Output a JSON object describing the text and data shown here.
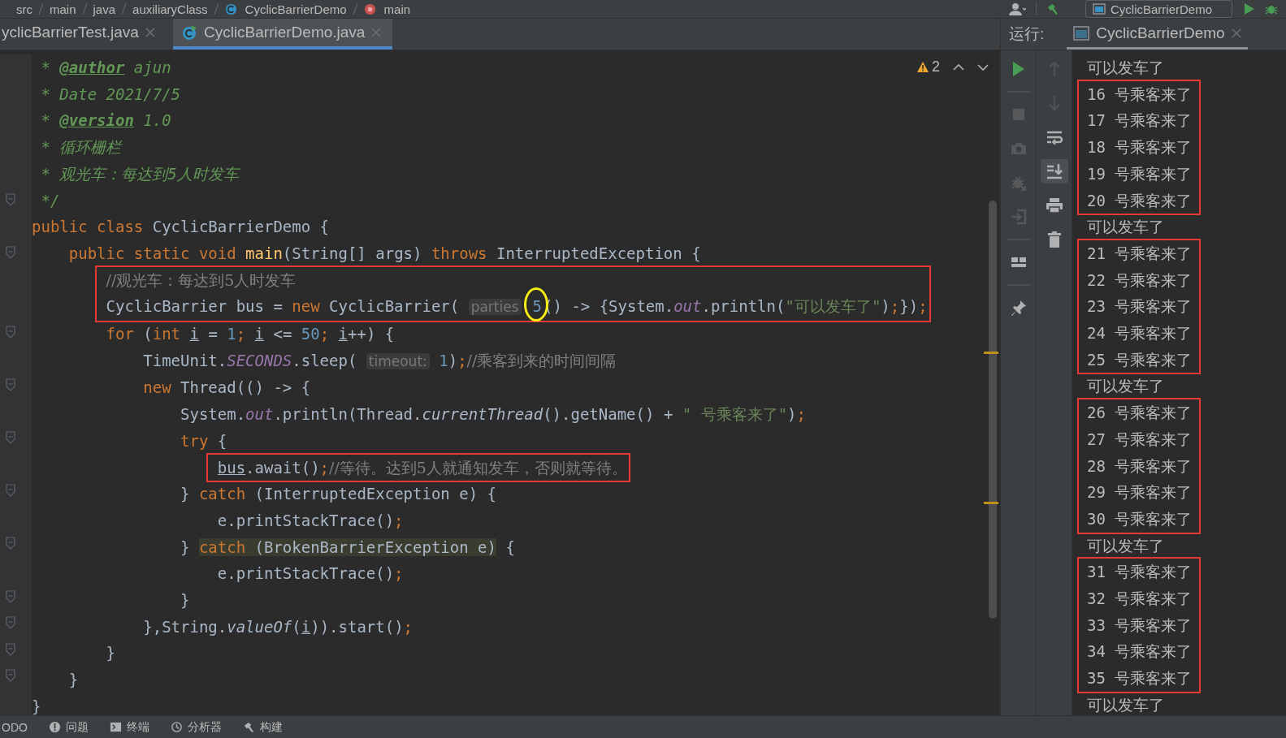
{
  "breadcrumb": [
    {
      "kind": "folder",
      "label": "src"
    },
    {
      "kind": "folder",
      "label": "main"
    },
    {
      "kind": "folder",
      "label": "java"
    },
    {
      "kind": "folder",
      "label": "auxiliaryClass"
    },
    {
      "kind": "class",
      "label": "CyclicBarrierDemo"
    },
    {
      "kind": "method",
      "label": "main"
    }
  ],
  "run_config": {
    "label": "CyclicBarrierDemo"
  },
  "editor_tabs": [
    {
      "label": "yclicBarrierTest.java",
      "selected": false
    },
    {
      "label": "CyclicBarrierDemo.java",
      "selected": true
    }
  ],
  "inspections": {
    "warnings": "2"
  },
  "code": [
    {
      "kind": "doc",
      "fold": false,
      "tokens": [
        {
          "kind": "doc",
          "text": "* "
        },
        {
          "kind": "tag",
          "text": "@author"
        },
        {
          "kind": "doc",
          "text": " ajun"
        }
      ]
    },
    {
      "kind": "doc",
      "fold": false,
      "tokens": [
        {
          "kind": "doc",
          "text": "* Date 2021/7/5"
        }
      ]
    },
    {
      "kind": "doc",
      "fold": false,
      "tokens": [
        {
          "kind": "doc",
          "text": "* "
        },
        {
          "kind": "tag",
          "text": "@version"
        },
        {
          "kind": "doc",
          "text": " 1.0"
        }
      ]
    },
    {
      "kind": "doc",
      "fold": false,
      "tokens": [
        {
          "kind": "doc",
          "text": "* 循环栅栏"
        }
      ]
    },
    {
      "kind": "doc",
      "fold": false,
      "tokens": [
        {
          "kind": "doc",
          "text": "* 观光车：每达到5人时发车"
        }
      ]
    },
    {
      "kind": "doc",
      "fold": true,
      "tokens": [
        {
          "kind": "doc",
          "text": "*/"
        }
      ]
    },
    {
      "kind": "line",
      "fold": false,
      "tokens": [
        {
          "kind": "kw",
          "text": "public class "
        },
        {
          "kind": "p",
          "text": "CyclicBarrierDemo {"
        }
      ],
      "children": [
        {
          "kind": "line",
          "fold": true,
          "tokens": [
            {
              "kind": "kw",
              "text": "public static void "
            },
            {
              "kind": "fn",
              "text": "main"
            },
            {
              "kind": "p",
              "text": "(String[] args) "
            },
            {
              "kind": "kw",
              "text": "throws "
            },
            {
              "kind": "p",
              "text": "InterruptedException {"
            }
          ],
          "children": [
            {
              "kind": "box",
              "lines": [
                {
                  "fold": false,
                  "tokens": [
                    {
                      "kind": "cm",
                      "text": "//观光车：每达到5人时发车"
                    }
                  ]
                },
                {
                  "fold": false,
                  "tokens": [
                    {
                      "kind": "p",
                      "text": "CyclicBarrier bus = "
                    },
                    {
                      "kind": "kw",
                      "text": "new "
                    },
                    {
                      "kind": "p",
                      "text": "CyclicBarrier( "
                    },
                    {
                      "kind": "hint",
                      "text": "parties"
                    },
                    {
                      "kind": "circ",
                      "text": "5"
                    },
                    {
                      "kind": "p",
                      "text": "() -> {System."
                    },
                    {
                      "kind": "fld",
                      "text": "out"
                    },
                    {
                      "kind": "p",
                      "text": ".println("
                    },
                    {
                      "kind": "str",
                      "text": "\"可以发车了\""
                    },
                    {
                      "kind": "p",
                      "text": ")"
                    },
                    {
                      "kind": "kw",
                      "text": ";"
                    },
                    {
                      "kind": "p",
                      "text": "})"
                    },
                    {
                      "kind": "kw",
                      "text": ";"
                    }
                  ]
                }
              ]
            },
            {
              "kind": "line",
              "fold": true,
              "tokens": [
                {
                  "kind": "kw",
                  "text": "for "
                },
                {
                  "kind": "p",
                  "text": "("
                },
                {
                  "kind": "kw",
                  "text": "int "
                },
                {
                  "kind": "var",
                  "text": "i"
                },
                {
                  "kind": "p",
                  "text": " = "
                },
                {
                  "kind": "num",
                  "text": "1"
                },
                {
                  "kind": "kw",
                  "text": "; "
                },
                {
                  "kind": "var",
                  "text": "i"
                },
                {
                  "kind": "p",
                  "text": " <= "
                },
                {
                  "kind": "num",
                  "text": "50"
                },
                {
                  "kind": "kw",
                  "text": "; "
                },
                {
                  "kind": "var",
                  "text": "i"
                },
                {
                  "kind": "p",
                  "text": "++) {"
                }
              ],
              "children": [
                {
                  "kind": "line",
                  "fold": false,
                  "tokens": [
                    {
                      "kind": "p",
                      "text": "TimeUnit."
                    },
                    {
                      "kind": "fld",
                      "text": "SECONDS"
                    },
                    {
                      "kind": "p",
                      "text": ".sleep( "
                    },
                    {
                      "kind": "hint",
                      "text": "timeout:"
                    },
                    {
                      "kind": "num",
                      "text": "1"
                    },
                    {
                      "kind": "p",
                      "text": ")"
                    },
                    {
                      "kind": "kw",
                      "text": ";"
                    },
                    {
                      "kind": "cm",
                      "text": "//乘客到来的时间间隔"
                    }
                  ]
                },
                {
                  "kind": "line",
                  "fold": true,
                  "tokens": [
                    {
                      "kind": "kw",
                      "text": "new "
                    },
                    {
                      "kind": "p",
                      "text": "Thread(() -> {"
                    }
                  ],
                  "children": [
                    {
                      "kind": "line",
                      "fold": false,
                      "tokens": [
                        {
                          "kind": "p",
                          "text": "System."
                        },
                        {
                          "kind": "fld",
                          "text": "out"
                        },
                        {
                          "kind": "p",
                          "text": ".println(Thread."
                        },
                        {
                          "kind": "itm",
                          "text": "currentThread"
                        },
                        {
                          "kind": "p",
                          "text": "().getName() + "
                        },
                        {
                          "kind": "str",
                          "text": "\" 号乘客来了\""
                        },
                        {
                          "kind": "p",
                          "text": ")"
                        },
                        {
                          "kind": "kw",
                          "text": ";"
                        }
                      ]
                    },
                    {
                      "kind": "line",
                      "fold": true,
                      "tokens": [
                        {
                          "kind": "kw",
                          "text": "try "
                        },
                        {
                          "kind": "p",
                          "text": "{"
                        }
                      ],
                      "children": [
                        {
                          "kind": "box",
                          "lines": [
                            {
                              "fold": false,
                              "tokens": [
                                {
                                  "kind": "ul",
                                  "text": "bus"
                                },
                                {
                                  "kind": "p",
                                  "text": ".await()"
                                },
                                {
                                  "kind": "kw",
                                  "text": ";"
                                },
                                {
                                  "kind": "cm",
                                  "text": "//等待。达到5人就通知发车，否则就等待。"
                                }
                              ]
                            }
                          ]
                        }
                      ]
                    },
                    {
                      "kind": "line",
                      "fold": true,
                      "tokens": [
                        {
                          "kind": "p",
                          "text": "} "
                        },
                        {
                          "kind": "kw",
                          "text": "catch "
                        },
                        {
                          "kind": "p",
                          "text": "(InterruptedException e) {"
                        }
                      ],
                      "children": [
                        {
                          "kind": "line",
                          "fold": false,
                          "tokens": [
                            {
                              "kind": "p",
                              "text": "e.printStackTrace()"
                            },
                            {
                              "kind": "kw",
                              "text": ";"
                            }
                          ]
                        }
                      ]
                    },
                    {
                      "kind": "line",
                      "fold": true,
                      "tokens": [
                        {
                          "kind": "p",
                          "text": "} "
                        },
                        {
                          "kind": "hlkw",
                          "text": "catch"
                        },
                        {
                          "kind": "hl",
                          "text": " (BrokenBarrierException e)"
                        },
                        {
                          "kind": "p",
                          "text": " {"
                        }
                      ],
                      "children": [
                        {
                          "kind": "line",
                          "fold": false,
                          "tokens": [
                            {
                              "kind": "p",
                              "text": "e.printStackTrace()"
                            },
                            {
                              "kind": "kw",
                              "text": ";"
                            }
                          ]
                        }
                      ]
                    },
                    {
                      "kind": "line",
                      "fold": true,
                      "tokens": [
                        {
                          "kind": "p",
                          "text": "}"
                        }
                      ]
                    }
                  ]
                },
                {
                  "kind": "line",
                  "fold": true,
                  "tokens": [
                    {
                      "kind": "p",
                      "text": "},String."
                    },
                    {
                      "kind": "itm",
                      "text": "valueOf"
                    },
                    {
                      "kind": "p",
                      "text": "("
                    },
                    {
                      "kind": "var",
                      "text": "i"
                    },
                    {
                      "kind": "p",
                      "text": ")).start()"
                    },
                    {
                      "kind": "kw",
                      "text": ";"
                    }
                  ]
                }
              ]
            },
            {
              "kind": "line",
              "fold": true,
              "tokens": [
                {
                  "kind": "p",
                  "text": "}"
                }
              ]
            }
          ]
        },
        {
          "kind": "line",
          "fold": true,
          "tokens": [
            {
              "kind": "p",
              "text": "}"
            }
          ]
        }
      ]
    },
    {
      "kind": "line",
      "fold": false,
      "tokens": [
        {
          "kind": "p",
          "text": "}"
        }
      ]
    }
  ],
  "run_panel": {
    "title": "运行:",
    "tab": {
      "label": "CyclicBarrierDemo",
      "selected": true
    }
  },
  "run_tools_left": [
    {
      "kind": "run",
      "disabled": false
    },
    {
      "kind": "separator"
    },
    {
      "kind": "stop",
      "disabled": true
    },
    {
      "kind": "camera",
      "disabled": true
    },
    {
      "kind": "bug",
      "disabled": true
    },
    {
      "kind": "enter",
      "disabled": true
    },
    {
      "kind": "separator"
    },
    {
      "kind": "layout",
      "disabled": false
    },
    {
      "kind": "separator"
    },
    {
      "kind": "pin",
      "disabled": false
    }
  ],
  "run_tools_right": [
    {
      "kind": "up",
      "disabled": true,
      "on": false
    },
    {
      "kind": "down",
      "disabled": true,
      "on": false
    },
    {
      "kind": "wrap",
      "disabled": false,
      "on": false
    },
    {
      "kind": "scroll",
      "disabled": false,
      "on": true
    },
    {
      "kind": "print",
      "disabled": false,
      "on": false
    },
    {
      "kind": "trash",
      "disabled": false,
      "on": false
    }
  ],
  "console": [
    {
      "kind": "line",
      "text": "可以发车了"
    },
    {
      "kind": "box",
      "lines": [
        "16 号乘客来了",
        "17 号乘客来了",
        "18 号乘客来了",
        "19 号乘客来了",
        "20 号乘客来了"
      ]
    },
    {
      "kind": "line",
      "text": "可以发车了"
    },
    {
      "kind": "box",
      "lines": [
        "21 号乘客来了",
        "22 号乘客来了",
        "23 号乘客来了",
        "24 号乘客来了",
        "25 号乘客来了"
      ]
    },
    {
      "kind": "line",
      "text": "可以发车了"
    },
    {
      "kind": "box",
      "lines": [
        "26 号乘客来了",
        "27 号乘客来了",
        "28 号乘客来了",
        "29 号乘客来了",
        "30 号乘客来了"
      ]
    },
    {
      "kind": "line",
      "text": "可以发车了"
    },
    {
      "kind": "box",
      "lines": [
        "31 号乘客来了",
        "32 号乘客来了",
        "33 号乘客来了",
        "34 号乘客来了",
        "35 号乘客来了"
      ]
    },
    {
      "kind": "line",
      "text": "可以发车了"
    }
  ],
  "status_bar": [
    {
      "kind": "todo",
      "label": "ODO"
    },
    {
      "kind": "problems",
      "label": "问题"
    },
    {
      "kind": "terminal",
      "label": "终端"
    },
    {
      "kind": "profiler",
      "label": "分析器"
    },
    {
      "kind": "build",
      "label": "构建"
    }
  ]
}
